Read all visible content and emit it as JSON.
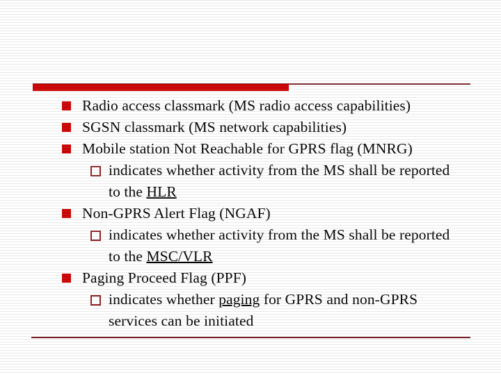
{
  "slide": {
    "title_rule": {
      "bar_color": "#CC0000",
      "rule_color": "#7B1F25"
    },
    "background_color": "#ffffff",
    "text_color": "#000000",
    "bullet_level1_color": "#CC0000",
    "bullet_level2_color": "#8B2020",
    "bullets": [
      {
        "level": 1,
        "marker": "filled-square-bullet",
        "text": "Radio access classmark (MS radio access capabilities)"
      },
      {
        "level": 1,
        "marker": "filled-square-bullet",
        "text": "SGSN classmark (MS network capabilities)"
      },
      {
        "level": 1,
        "marker": "filled-square-bullet",
        "text": "Mobile station Not Reachable for GPRS flag (MNRG)"
      },
      {
        "level": 2,
        "marker": "hollow-square-bullet",
        "text_before": "indicates whether activity from the MS shall be reported to the ",
        "underlined": "HLR",
        "text_after": ""
      },
      {
        "level": 1,
        "marker": "filled-square-bullet",
        "text": "Non-GPRS Alert Flag (NGAF)"
      },
      {
        "level": 2,
        "marker": "hollow-square-bullet",
        "text_before": "indicates whether activity from the MS shall be reported to the ",
        "underlined": "MSC/VLR",
        "text_after": ""
      },
      {
        "level": 1,
        "marker": "filled-square-bullet",
        "text": "Paging Proceed Flag (PPF)"
      },
      {
        "level": 2,
        "marker": "hollow-square-bullet",
        "text_before": "indicates whether ",
        "underlined": "paging",
        "text_after": " for GPRS and non-GPRS services can be initiated"
      }
    ]
  }
}
